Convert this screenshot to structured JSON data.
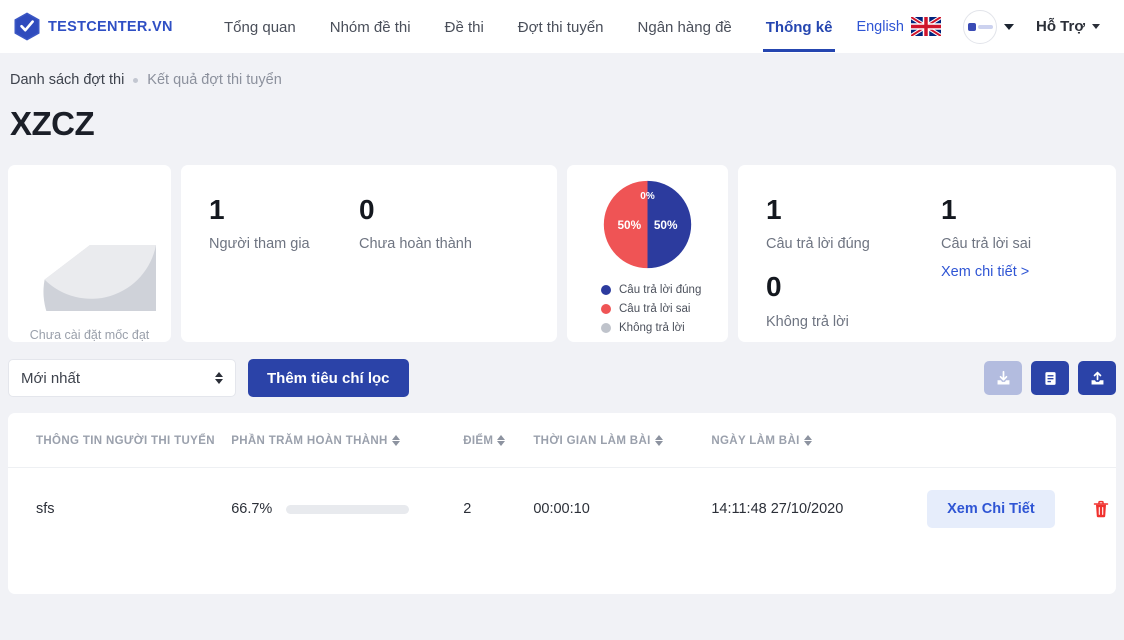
{
  "brand": {
    "name": "TESTCENTER.VN",
    "logo_icon": "hexagon-check-icon",
    "accent": "#2f4fc4"
  },
  "nav": {
    "items": [
      {
        "label": "Tổng quan",
        "active": false
      },
      {
        "label": "Nhóm đề thi",
        "active": false
      },
      {
        "label": "Đề thi",
        "active": false
      },
      {
        "label": "Đợt thi tuyển",
        "active": false
      },
      {
        "label": "Ngân hàng đề",
        "active": false
      },
      {
        "label": "Thống kê",
        "active": true
      }
    ],
    "language": {
      "label": "English",
      "flag_icon": "uk-flag-icon"
    },
    "account": {
      "avatar_icon": "user-avatar-icon",
      "caret_icon": "chevron-down-icon"
    },
    "support": {
      "label": "Hỗ Trợ",
      "caret_icon": "chevron-down-icon"
    }
  },
  "breadcrumb": {
    "parent": "Danh sách đợt thi",
    "current": "Kết quả đợt thi tuyển"
  },
  "page_title": "XZCZ",
  "cards": {
    "threshold_pie": {
      "caption": "Chưa cài đặt mốc đạt",
      "colors": {
        "segment_a": "#cfd2d9",
        "segment_b": "#e9eaee"
      }
    },
    "participation": [
      {
        "value": "1",
        "label": "Người tham gia"
      },
      {
        "value": "0",
        "label": "Chưa hoàn thành"
      }
    ],
    "answers_pie": {
      "slices": [
        {
          "label": "Câu trả lời đúng",
          "percent": "50%",
          "color": "#2c3b9e"
        },
        {
          "label": "Câu trả lời sai",
          "percent": "50%",
          "color": "#ef5455"
        },
        {
          "label": "Không trả lời",
          "percent": "0%",
          "color": "#bfc3cb"
        }
      ]
    },
    "answers_counts": {
      "correct": {
        "value": "1",
        "label": "Câu trả lời đúng"
      },
      "wrong": {
        "value": "1",
        "label": "Câu trả lời sai"
      },
      "unanswered": {
        "value": "0",
        "label": "Không trả lời"
      },
      "detail_link": "Xem chi tiết >"
    }
  },
  "filters": {
    "sort_select": {
      "value": "Mới nhất",
      "icon": "updown-arrows-icon"
    },
    "add_filter_button": "Thêm tiêu chí lọc",
    "actions": [
      {
        "name": "download-button",
        "icon": "download-icon",
        "state": "disabled"
      },
      {
        "name": "report-button",
        "icon": "document-icon",
        "state": "enabled"
      },
      {
        "name": "upload-button",
        "icon": "upload-icon",
        "state": "enabled"
      }
    ]
  },
  "table": {
    "columns": [
      {
        "label": "THÔNG TIN NGƯỜI THI TUYỂN",
        "sortable": false
      },
      {
        "label": "PHẦN TRĂM HOÀN THÀNH",
        "sortable": true
      },
      {
        "label": "ĐIỂM",
        "sortable": true
      },
      {
        "label": "THỜI GIAN LÀM BÀI",
        "sortable": true
      },
      {
        "label": "NGÀY LÀM BÀI",
        "sortable": true
      }
    ],
    "rows": [
      {
        "name": "sfs",
        "percent_text": "66.7%",
        "percent_value": 66.7,
        "score": "2",
        "duration": "00:00:10",
        "date": "14:11:48 27/10/2020",
        "detail_button": "Xem Chi Tiết",
        "delete_icon": "trash-icon"
      }
    ]
  }
}
